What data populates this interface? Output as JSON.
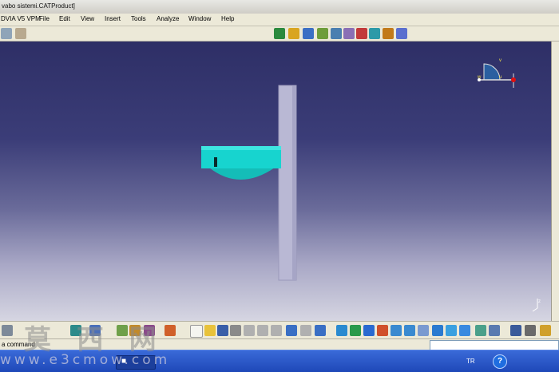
{
  "window": {
    "title": "vabo sistemi.CATProduct]"
  },
  "menu": [
    {
      "label": "DVIA V5 VPM"
    },
    {
      "label": "File"
    },
    {
      "label": "Edit"
    },
    {
      "label": "View"
    },
    {
      "label": "Insert"
    },
    {
      "label": "Tools"
    },
    {
      "label": "Analyze"
    },
    {
      "label": "Window"
    },
    {
      "label": "Help"
    }
  ],
  "compass": {
    "v": "v",
    "u": "u",
    "w": "w"
  },
  "axis": {
    "z": "z"
  },
  "status": {
    "prompt": "a command"
  },
  "taskbar": {
    "lang": "TR",
    "help": "?"
  },
  "watermark": {
    "chinese": "莫 西 网",
    "url": "www.e3cmow.com"
  },
  "colors": {
    "part_cyan": "#17d4cf",
    "wall": "#b9b8d4",
    "viewport_top": "#2e2f66",
    "viewport_bottom": "#d6d6e2"
  }
}
